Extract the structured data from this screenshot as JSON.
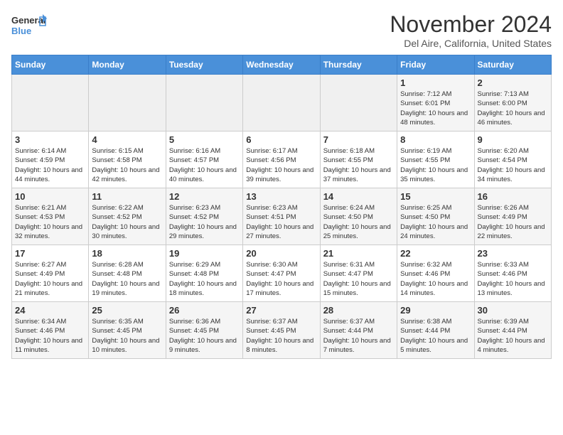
{
  "header": {
    "logo": {
      "line1": "General",
      "line2": "Blue"
    },
    "title": "November 2024",
    "location": "Del Aire, California, United States"
  },
  "weekdays": [
    "Sunday",
    "Monday",
    "Tuesday",
    "Wednesday",
    "Thursday",
    "Friday",
    "Saturday"
  ],
  "weeks": [
    [
      {
        "day": "",
        "sunrise": "",
        "sunset": "",
        "daylight": ""
      },
      {
        "day": "",
        "sunrise": "",
        "sunset": "",
        "daylight": ""
      },
      {
        "day": "",
        "sunrise": "",
        "sunset": "",
        "daylight": ""
      },
      {
        "day": "",
        "sunrise": "",
        "sunset": "",
        "daylight": ""
      },
      {
        "day": "",
        "sunrise": "",
        "sunset": "",
        "daylight": ""
      },
      {
        "day": "1",
        "sunrise": "Sunrise: 7:12 AM",
        "sunset": "Sunset: 6:01 PM",
        "daylight": "Daylight: 10 hours and 48 minutes."
      },
      {
        "day": "2",
        "sunrise": "Sunrise: 7:13 AM",
        "sunset": "Sunset: 6:00 PM",
        "daylight": "Daylight: 10 hours and 46 minutes."
      }
    ],
    [
      {
        "day": "3",
        "sunrise": "Sunrise: 6:14 AM",
        "sunset": "Sunset: 4:59 PM",
        "daylight": "Daylight: 10 hours and 44 minutes."
      },
      {
        "day": "4",
        "sunrise": "Sunrise: 6:15 AM",
        "sunset": "Sunset: 4:58 PM",
        "daylight": "Daylight: 10 hours and 42 minutes."
      },
      {
        "day": "5",
        "sunrise": "Sunrise: 6:16 AM",
        "sunset": "Sunset: 4:57 PM",
        "daylight": "Daylight: 10 hours and 40 minutes."
      },
      {
        "day": "6",
        "sunrise": "Sunrise: 6:17 AM",
        "sunset": "Sunset: 4:56 PM",
        "daylight": "Daylight: 10 hours and 39 minutes."
      },
      {
        "day": "7",
        "sunrise": "Sunrise: 6:18 AM",
        "sunset": "Sunset: 4:55 PM",
        "daylight": "Daylight: 10 hours and 37 minutes."
      },
      {
        "day": "8",
        "sunrise": "Sunrise: 6:19 AM",
        "sunset": "Sunset: 4:55 PM",
        "daylight": "Daylight: 10 hours and 35 minutes."
      },
      {
        "day": "9",
        "sunrise": "Sunrise: 6:20 AM",
        "sunset": "Sunset: 4:54 PM",
        "daylight": "Daylight: 10 hours and 34 minutes."
      }
    ],
    [
      {
        "day": "10",
        "sunrise": "Sunrise: 6:21 AM",
        "sunset": "Sunset: 4:53 PM",
        "daylight": "Daylight: 10 hours and 32 minutes."
      },
      {
        "day": "11",
        "sunrise": "Sunrise: 6:22 AM",
        "sunset": "Sunset: 4:52 PM",
        "daylight": "Daylight: 10 hours and 30 minutes."
      },
      {
        "day": "12",
        "sunrise": "Sunrise: 6:23 AM",
        "sunset": "Sunset: 4:52 PM",
        "daylight": "Daylight: 10 hours and 29 minutes."
      },
      {
        "day": "13",
        "sunrise": "Sunrise: 6:23 AM",
        "sunset": "Sunset: 4:51 PM",
        "daylight": "Daylight: 10 hours and 27 minutes."
      },
      {
        "day": "14",
        "sunrise": "Sunrise: 6:24 AM",
        "sunset": "Sunset: 4:50 PM",
        "daylight": "Daylight: 10 hours and 25 minutes."
      },
      {
        "day": "15",
        "sunrise": "Sunrise: 6:25 AM",
        "sunset": "Sunset: 4:50 PM",
        "daylight": "Daylight: 10 hours and 24 minutes."
      },
      {
        "day": "16",
        "sunrise": "Sunrise: 6:26 AM",
        "sunset": "Sunset: 4:49 PM",
        "daylight": "Daylight: 10 hours and 22 minutes."
      }
    ],
    [
      {
        "day": "17",
        "sunrise": "Sunrise: 6:27 AM",
        "sunset": "Sunset: 4:49 PM",
        "daylight": "Daylight: 10 hours and 21 minutes."
      },
      {
        "day": "18",
        "sunrise": "Sunrise: 6:28 AM",
        "sunset": "Sunset: 4:48 PM",
        "daylight": "Daylight: 10 hours and 19 minutes."
      },
      {
        "day": "19",
        "sunrise": "Sunrise: 6:29 AM",
        "sunset": "Sunset: 4:48 PM",
        "daylight": "Daylight: 10 hours and 18 minutes."
      },
      {
        "day": "20",
        "sunrise": "Sunrise: 6:30 AM",
        "sunset": "Sunset: 4:47 PM",
        "daylight": "Daylight: 10 hours and 17 minutes."
      },
      {
        "day": "21",
        "sunrise": "Sunrise: 6:31 AM",
        "sunset": "Sunset: 4:47 PM",
        "daylight": "Daylight: 10 hours and 15 minutes."
      },
      {
        "day": "22",
        "sunrise": "Sunrise: 6:32 AM",
        "sunset": "Sunset: 4:46 PM",
        "daylight": "Daylight: 10 hours and 14 minutes."
      },
      {
        "day": "23",
        "sunrise": "Sunrise: 6:33 AM",
        "sunset": "Sunset: 4:46 PM",
        "daylight": "Daylight: 10 hours and 13 minutes."
      }
    ],
    [
      {
        "day": "24",
        "sunrise": "Sunrise: 6:34 AM",
        "sunset": "Sunset: 4:46 PM",
        "daylight": "Daylight: 10 hours and 11 minutes."
      },
      {
        "day": "25",
        "sunrise": "Sunrise: 6:35 AM",
        "sunset": "Sunset: 4:45 PM",
        "daylight": "Daylight: 10 hours and 10 minutes."
      },
      {
        "day": "26",
        "sunrise": "Sunrise: 6:36 AM",
        "sunset": "Sunset: 4:45 PM",
        "daylight": "Daylight: 10 hours and 9 minutes."
      },
      {
        "day": "27",
        "sunrise": "Sunrise: 6:37 AM",
        "sunset": "Sunset: 4:45 PM",
        "daylight": "Daylight: 10 hours and 8 minutes."
      },
      {
        "day": "28",
        "sunrise": "Sunrise: 6:37 AM",
        "sunset": "Sunset: 4:44 PM",
        "daylight": "Daylight: 10 hours and 7 minutes."
      },
      {
        "day": "29",
        "sunrise": "Sunrise: 6:38 AM",
        "sunset": "Sunset: 4:44 PM",
        "daylight": "Daylight: 10 hours and 5 minutes."
      },
      {
        "day": "30",
        "sunrise": "Sunrise: 6:39 AM",
        "sunset": "Sunset: 4:44 PM",
        "daylight": "Daylight: 10 hours and 4 minutes."
      }
    ]
  ]
}
